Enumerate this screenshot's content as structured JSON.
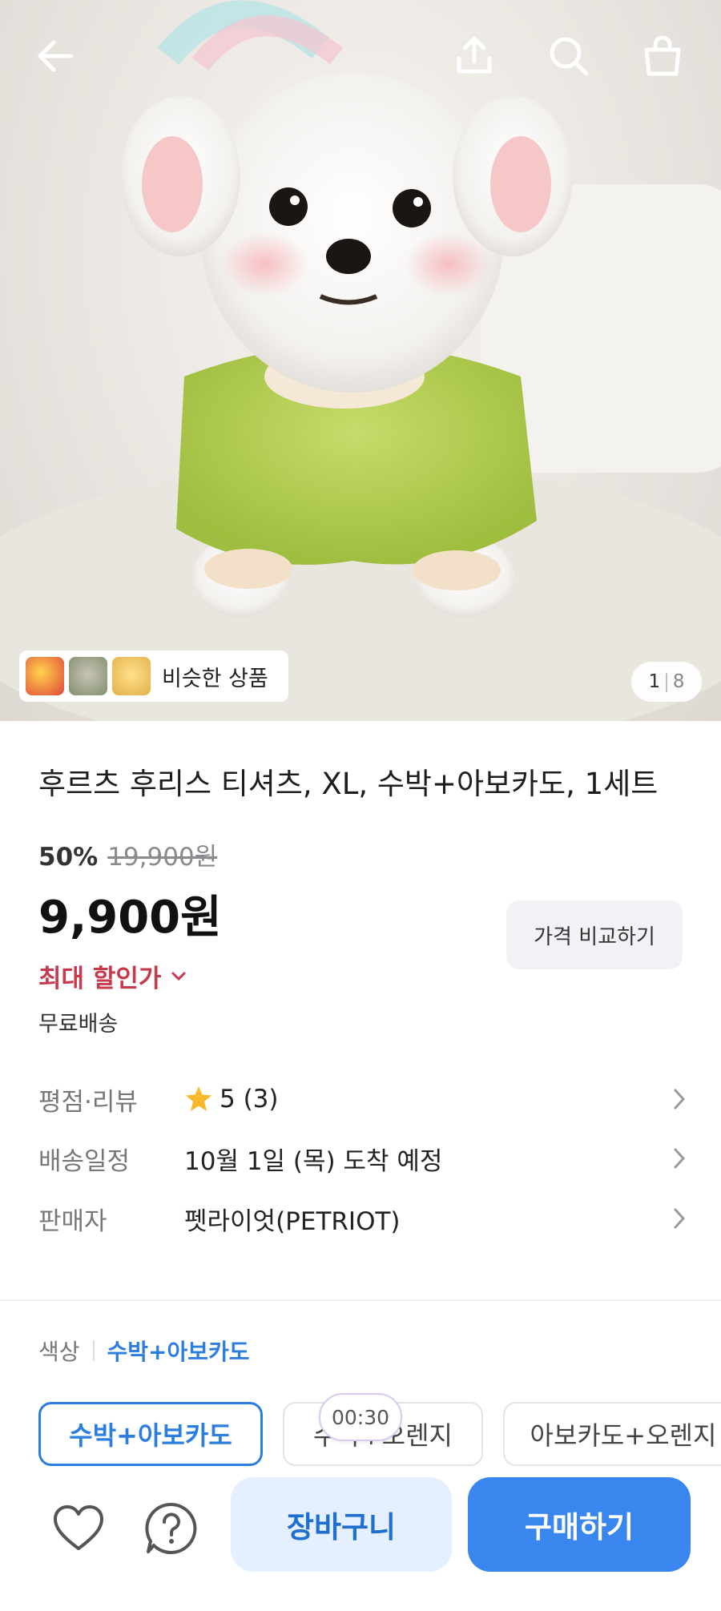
{
  "header": {
    "back_icon": "arrow-left-icon",
    "share_icon": "share-upload-icon",
    "search_icon": "search-icon",
    "cart_icon": "shopping-bag-icon"
  },
  "gallery": {
    "similar_label": "비슷한 상품",
    "current_page": "1",
    "total_pages": "8"
  },
  "product": {
    "title": "후르츠 후리스 티셔츠, XL, 수박+아보카도, 1세트",
    "discount_percent": "50%",
    "original_price": "19,900원",
    "price": "9,900원",
    "compare_label": "가격 비교하기",
    "max_discount_label": "최대 할인가",
    "shipping_label": "무료배송"
  },
  "details": [
    {
      "key": "평점·리뷰",
      "value": "5 (3)"
    },
    {
      "key": "배송일정",
      "value": "10월 1일 (목) 도착 예정"
    },
    {
      "key": "판매자",
      "value": "펫라이엇(PETRIOT)"
    }
  ],
  "rating": {
    "stars_icon": "star-icon"
  },
  "options": {
    "color_label": "색상",
    "selected_color": "수박+아보카도",
    "chips": [
      "수박+아보카도",
      "수박+오렌지",
      "아보카도+오렌지"
    ],
    "timer": "00:30"
  },
  "actions": {
    "cart_label": "장바구니",
    "buy_label": "구매하기",
    "favorite_icon": "heart-icon",
    "help_icon": "question-icon"
  },
  "colors": {
    "accent": "#3a86ef",
    "accent_light": "#e4f0fd",
    "discount_red": "#c8394c",
    "link_blue": "#2b7de0"
  }
}
